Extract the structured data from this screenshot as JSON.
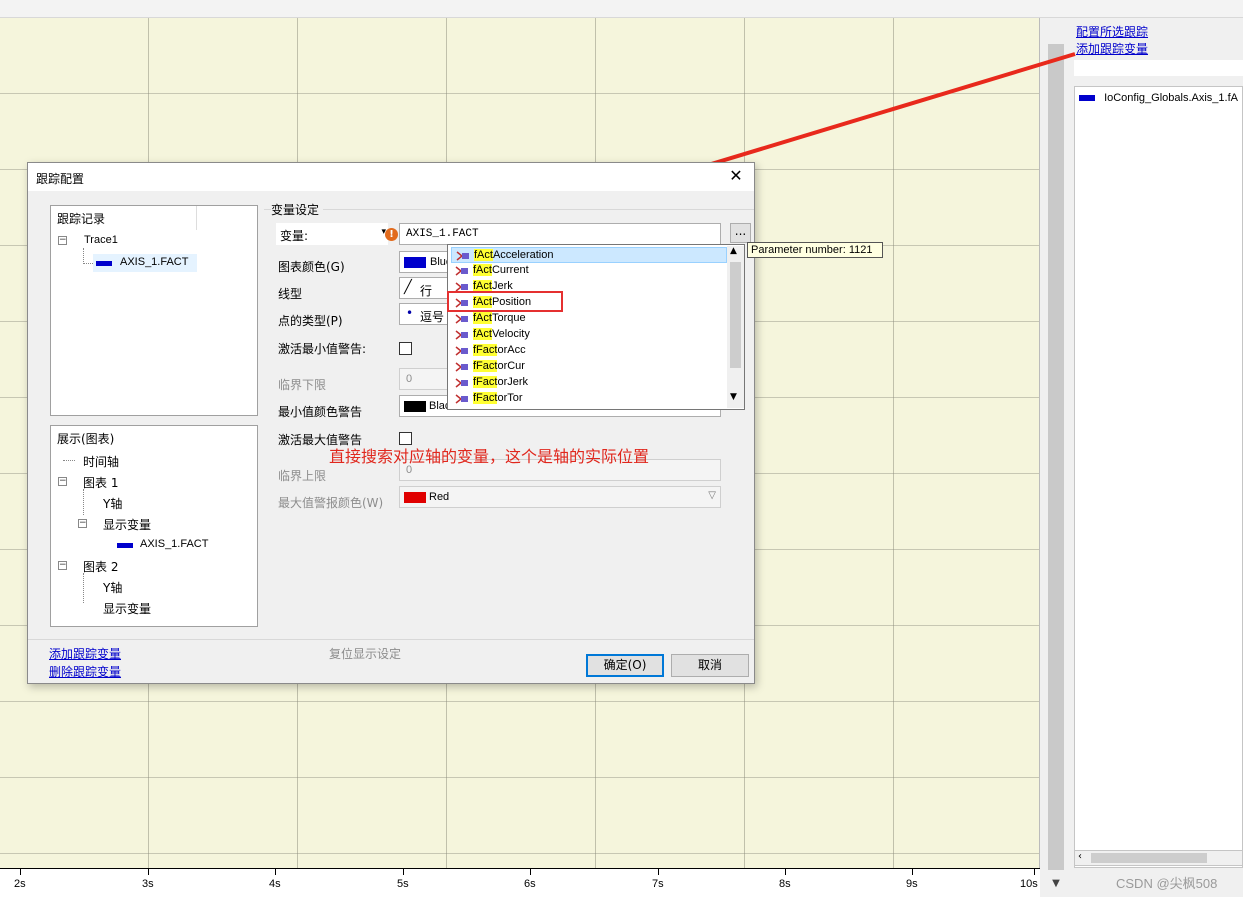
{
  "side": {
    "link_configure": "配置所选跟踪",
    "link_add": "添加跟踪变量",
    "trace_item": "IoConfig_Globals.Axis_1.fA",
    "watermark": "CSDN @尖枫508"
  },
  "axis": {
    "ticks": [
      "2s",
      "3s",
      "4s",
      "5s",
      "6s",
      "7s",
      "8s",
      "9s",
      "10s"
    ]
  },
  "dialog": {
    "title": "跟踪配置",
    "close_glyph": "✕",
    "left_top": {
      "header": "跟踪记录",
      "trace": "Trace1",
      "variable": "AXIS_1.FACT"
    },
    "left_bottom": {
      "header": "展示(图表)",
      "time_axis": "时间轴",
      "chart1": "图表 1",
      "y_axis_1": "Y轴",
      "display_vars_1": "显示变量",
      "var1": "AXIS_1.FACT",
      "chart2": "图表 2",
      "y_axis_2": "Y轴",
      "display_vars_2": "显示变量"
    },
    "settings": {
      "group_title": "变量设定",
      "variable_label": "变量:",
      "variable_value": "AXIS_1.FACT",
      "browse_button": "...",
      "chart_color_label": "图表颜色(G)",
      "chart_color_value": "Blue",
      "line_type_label": "线型",
      "line_type_value": "行",
      "point_type_label": "点的类型(P)",
      "point_type_value": "逗号",
      "min_warn_label": "激活最小值警告:",
      "lower_limit_label": "临界下限",
      "lower_limit_value": "0",
      "min_color_label": "最小值颜色警告",
      "min_color_value": "Black",
      "max_warn_label": "激活最大值警告",
      "upper_limit_label": "临界上限",
      "upper_limit_value": "0",
      "max_color_label": "最大值警报颜色(W)",
      "max_color_value": "Red"
    },
    "footer": {
      "add_link": "添加跟踪变量",
      "delete_link": "删除跟踪变量",
      "reset_display": "复位显示设定",
      "ok": "确定(O)",
      "cancel": "取消"
    }
  },
  "autocomplete": {
    "tooltip": "Parameter number: 1121",
    "items": [
      {
        "match": "fAct",
        "rest": "Acceleration",
        "selected": true
      },
      {
        "match": "fAct",
        "rest": "Current",
        "selected": false
      },
      {
        "match": "fAct",
        "rest": "Jerk",
        "selected": false
      },
      {
        "match": "fAct",
        "rest": "Position",
        "selected": false
      },
      {
        "match": "fAct",
        "rest": "Torque",
        "selected": false
      },
      {
        "match": "fAct",
        "rest": "Velocity",
        "selected": false
      },
      {
        "match": "fFact",
        "rest": "orAcc",
        "selected": false
      },
      {
        "match": "fFact",
        "rest": "orCur",
        "selected": false
      },
      {
        "match": "fFact",
        "rest": "orJerk",
        "selected": false
      },
      {
        "match": "fFact",
        "rest": "orTor",
        "selected": false
      }
    ]
  },
  "annotation_text": "直接搜索对应轴的变量，这个是轴的实际位置",
  "colors": {
    "plot_bg": "#f5f5dc",
    "trace_blue": "#0000cc",
    "warn_black": "#000000",
    "warn_red": "#e00000",
    "annotation_red": "#e0271d",
    "highlight_yellow": "#ffff33"
  }
}
